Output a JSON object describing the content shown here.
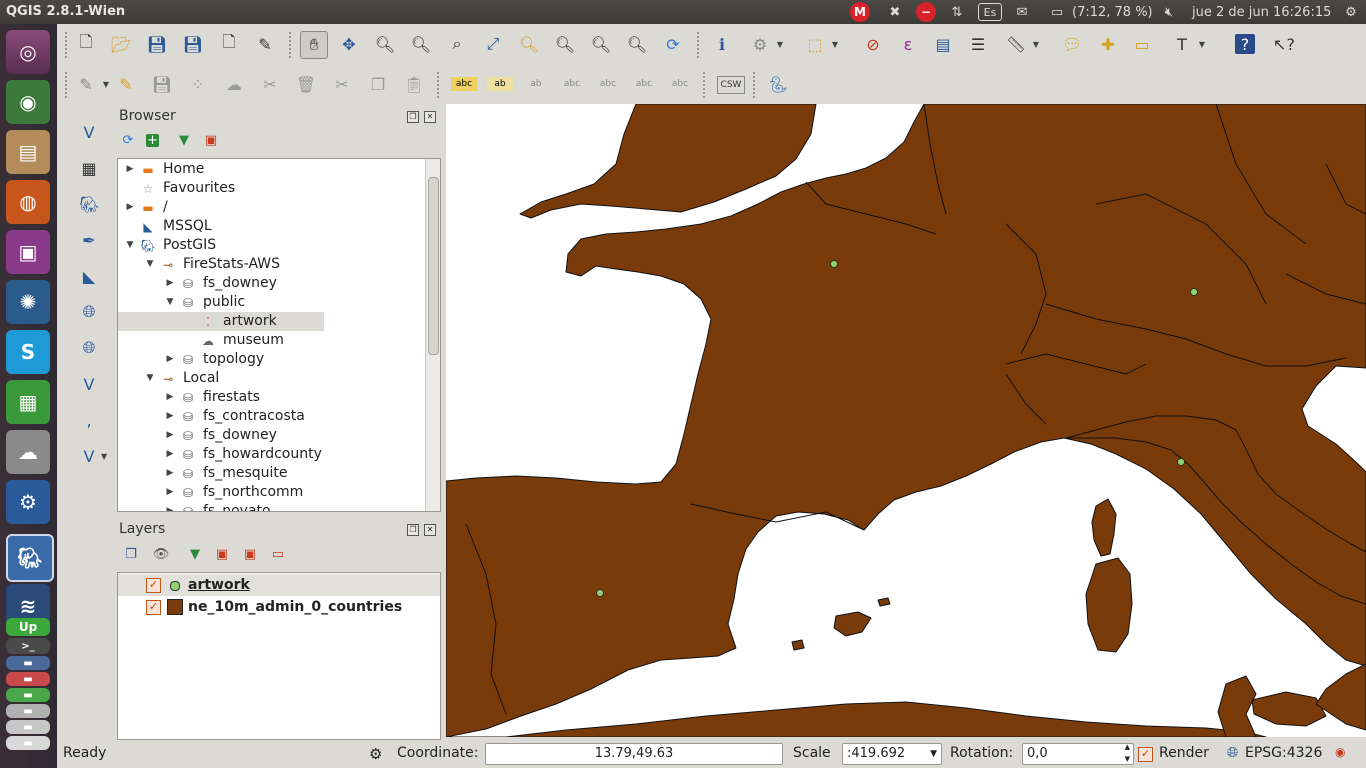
{
  "window": {
    "title": "QGIS 2.8.1-Wien"
  },
  "tray": {
    "battery": "(7:12, 78 %)",
    "clock": "jue 2 de jun 16:26:15",
    "keyboard": "Es",
    "mega": "M"
  },
  "browser": {
    "title": "Browser",
    "items": [
      {
        "label": "Home",
        "icon": "folder-icon",
        "arrow": "▶"
      },
      {
        "label": "Favourites",
        "icon": "star-icon",
        "arrow": ""
      },
      {
        "label": "/",
        "icon": "folder-icon",
        "arrow": "▶"
      },
      {
        "label": "MSSQL",
        "icon": "mssql-icon",
        "arrow": ""
      },
      {
        "label": "PostGIS",
        "icon": "elephant-icon",
        "arrow": "▼"
      },
      {
        "label": "FireStats-AWS",
        "icon": "connection-icon",
        "arrow": "▼"
      },
      {
        "label": "fs_downey",
        "icon": "database-icon",
        "arrow": "▶"
      },
      {
        "label": "public",
        "icon": "database-icon",
        "arrow": "▼"
      },
      {
        "label": "artwork",
        "icon": "point-layer-icon",
        "arrow": ""
      },
      {
        "label": "museum",
        "icon": "polygon-layer-icon",
        "arrow": ""
      },
      {
        "label": "topology",
        "icon": "database-icon",
        "arrow": "▶"
      },
      {
        "label": "Local",
        "icon": "connection-icon",
        "arrow": "▼"
      },
      {
        "label": "firestats",
        "icon": "database-icon",
        "arrow": "▶"
      },
      {
        "label": "fs_contracosta",
        "icon": "database-icon",
        "arrow": "▶"
      },
      {
        "label": "fs_downey",
        "icon": "database-icon",
        "arrow": "▶"
      },
      {
        "label": "fs_howardcounty",
        "icon": "database-icon",
        "arrow": "▶"
      },
      {
        "label": "fs_mesquite",
        "icon": "database-icon",
        "arrow": "▶"
      },
      {
        "label": "fs_northcomm",
        "icon": "database-icon",
        "arrow": "▶"
      },
      {
        "label": "fs_novato",
        "icon": "database-icon",
        "arrow": "▶"
      }
    ]
  },
  "layers": {
    "title": "Layers",
    "items": [
      {
        "label": "artwork",
        "checked": true,
        "symbol": "point",
        "color": "#8fd16f"
      },
      {
        "label": "ne_10m_admin_0_countries",
        "checked": true,
        "symbol": "fill",
        "color": "#7a3b0b"
      }
    ]
  },
  "map": {
    "land_color": "#7a3b0b",
    "sea_color": "#ffffff",
    "point_color": "#8fd16f"
  },
  "status": {
    "ready": "Ready",
    "coordinate_label": "Coordinate:",
    "coordinate_value": "13.79,49.63",
    "scale_label": "Scale",
    "scale_value": ":419.692",
    "rotation_label": "Rotation:",
    "rotation_value": "0,0",
    "render_label": "Render",
    "crs": "EPSG:4326"
  }
}
